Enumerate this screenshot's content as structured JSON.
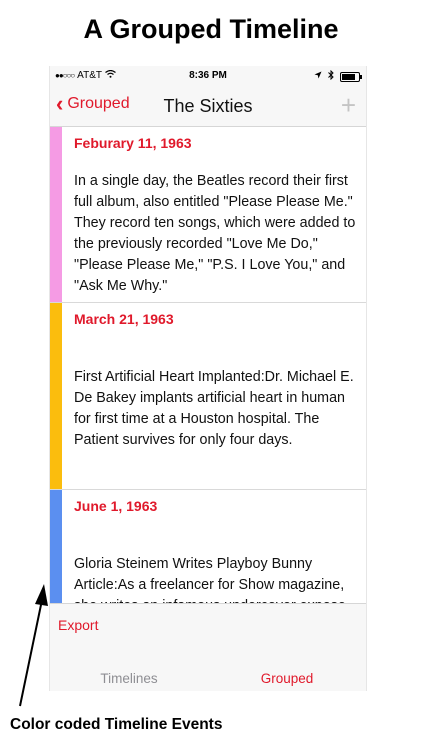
{
  "promo": {
    "title": "A Grouped Timeline",
    "caption": "Color coded Timeline Events"
  },
  "status_bar": {
    "carrier": "AT&T",
    "time": "8:36 PM"
  },
  "nav": {
    "back_label": "Grouped",
    "title": "The Sixties",
    "add_icon": "plus-icon"
  },
  "events": [
    {
      "date": "Feburary 11, 1963",
      "color": "#f59be4",
      "text": "In a single day, the Beatles record their first full album, also entitled \"Please Please Me.\" They record ten songs, which were added to the previously recorded \"Love Me Do,\" \"Please Please Me,\" \"P.S. I Love You,\" and \"Ask Me Why.\""
    },
    {
      "date": "March 21, 1963",
      "color": "#fbbd0d",
      "text": "First Artificial Heart Implanted:Dr. Michael E. De Bakey implants artificial heart in human for first time at a Houston hospital. The Patient survives for only four days."
    },
    {
      "date": "June 1, 1963",
      "color": "#5b8ff0",
      "text": "Gloria Steinem Writes Playboy Bunny Article:As a freelancer for Show magazine, she writes an infamous undercover expose"
    }
  ],
  "toolbar": {
    "export_label": "Export"
  },
  "tabs": [
    {
      "label": "Timelines",
      "selected": false
    },
    {
      "label": "Grouped",
      "selected": true
    }
  ],
  "colors": {
    "accent": "#e0192b",
    "inactive_tab": "#8e8e93"
  }
}
